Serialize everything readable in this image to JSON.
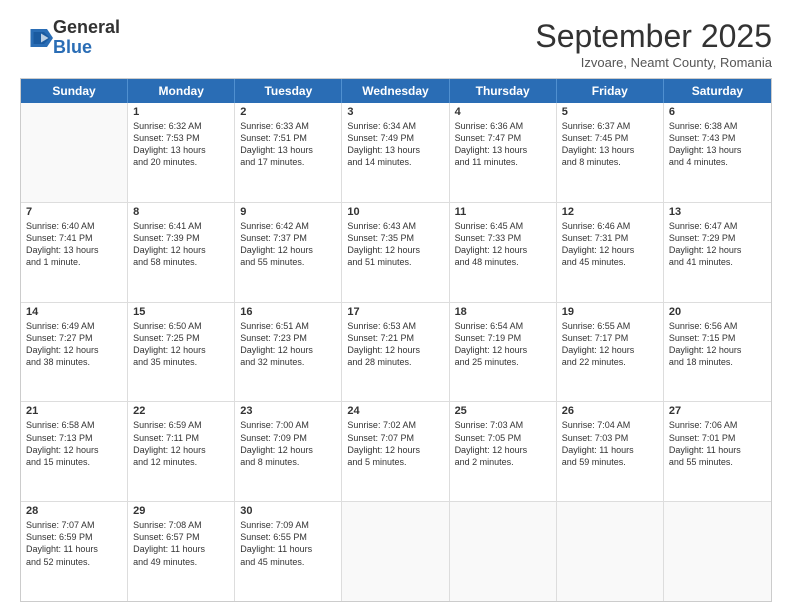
{
  "logo": {
    "general": "General",
    "blue": "Blue"
  },
  "header": {
    "title": "September 2025",
    "subtitle": "Izvoare, Neamt County, Romania"
  },
  "days": [
    "Sunday",
    "Monday",
    "Tuesday",
    "Wednesday",
    "Thursday",
    "Friday",
    "Saturday"
  ],
  "weeks": [
    [
      {
        "day": "",
        "lines": []
      },
      {
        "day": "1",
        "lines": [
          "Sunrise: 6:32 AM",
          "Sunset: 7:53 PM",
          "Daylight: 13 hours",
          "and 20 minutes."
        ]
      },
      {
        "day": "2",
        "lines": [
          "Sunrise: 6:33 AM",
          "Sunset: 7:51 PM",
          "Daylight: 13 hours",
          "and 17 minutes."
        ]
      },
      {
        "day": "3",
        "lines": [
          "Sunrise: 6:34 AM",
          "Sunset: 7:49 PM",
          "Daylight: 13 hours",
          "and 14 minutes."
        ]
      },
      {
        "day": "4",
        "lines": [
          "Sunrise: 6:36 AM",
          "Sunset: 7:47 PM",
          "Daylight: 13 hours",
          "and 11 minutes."
        ]
      },
      {
        "day": "5",
        "lines": [
          "Sunrise: 6:37 AM",
          "Sunset: 7:45 PM",
          "Daylight: 13 hours",
          "and 8 minutes."
        ]
      },
      {
        "day": "6",
        "lines": [
          "Sunrise: 6:38 AM",
          "Sunset: 7:43 PM",
          "Daylight: 13 hours",
          "and 4 minutes."
        ]
      }
    ],
    [
      {
        "day": "7",
        "lines": [
          "Sunrise: 6:40 AM",
          "Sunset: 7:41 PM",
          "Daylight: 13 hours",
          "and 1 minute."
        ]
      },
      {
        "day": "8",
        "lines": [
          "Sunrise: 6:41 AM",
          "Sunset: 7:39 PM",
          "Daylight: 12 hours",
          "and 58 minutes."
        ]
      },
      {
        "day": "9",
        "lines": [
          "Sunrise: 6:42 AM",
          "Sunset: 7:37 PM",
          "Daylight: 12 hours",
          "and 55 minutes."
        ]
      },
      {
        "day": "10",
        "lines": [
          "Sunrise: 6:43 AM",
          "Sunset: 7:35 PM",
          "Daylight: 12 hours",
          "and 51 minutes."
        ]
      },
      {
        "day": "11",
        "lines": [
          "Sunrise: 6:45 AM",
          "Sunset: 7:33 PM",
          "Daylight: 12 hours",
          "and 48 minutes."
        ]
      },
      {
        "day": "12",
        "lines": [
          "Sunrise: 6:46 AM",
          "Sunset: 7:31 PM",
          "Daylight: 12 hours",
          "and 45 minutes."
        ]
      },
      {
        "day": "13",
        "lines": [
          "Sunrise: 6:47 AM",
          "Sunset: 7:29 PM",
          "Daylight: 12 hours",
          "and 41 minutes."
        ]
      }
    ],
    [
      {
        "day": "14",
        "lines": [
          "Sunrise: 6:49 AM",
          "Sunset: 7:27 PM",
          "Daylight: 12 hours",
          "and 38 minutes."
        ]
      },
      {
        "day": "15",
        "lines": [
          "Sunrise: 6:50 AM",
          "Sunset: 7:25 PM",
          "Daylight: 12 hours",
          "and 35 minutes."
        ]
      },
      {
        "day": "16",
        "lines": [
          "Sunrise: 6:51 AM",
          "Sunset: 7:23 PM",
          "Daylight: 12 hours",
          "and 32 minutes."
        ]
      },
      {
        "day": "17",
        "lines": [
          "Sunrise: 6:53 AM",
          "Sunset: 7:21 PM",
          "Daylight: 12 hours",
          "and 28 minutes."
        ]
      },
      {
        "day": "18",
        "lines": [
          "Sunrise: 6:54 AM",
          "Sunset: 7:19 PM",
          "Daylight: 12 hours",
          "and 25 minutes."
        ]
      },
      {
        "day": "19",
        "lines": [
          "Sunrise: 6:55 AM",
          "Sunset: 7:17 PM",
          "Daylight: 12 hours",
          "and 22 minutes."
        ]
      },
      {
        "day": "20",
        "lines": [
          "Sunrise: 6:56 AM",
          "Sunset: 7:15 PM",
          "Daylight: 12 hours",
          "and 18 minutes."
        ]
      }
    ],
    [
      {
        "day": "21",
        "lines": [
          "Sunrise: 6:58 AM",
          "Sunset: 7:13 PM",
          "Daylight: 12 hours",
          "and 15 minutes."
        ]
      },
      {
        "day": "22",
        "lines": [
          "Sunrise: 6:59 AM",
          "Sunset: 7:11 PM",
          "Daylight: 12 hours",
          "and 12 minutes."
        ]
      },
      {
        "day": "23",
        "lines": [
          "Sunrise: 7:00 AM",
          "Sunset: 7:09 PM",
          "Daylight: 12 hours",
          "and 8 minutes."
        ]
      },
      {
        "day": "24",
        "lines": [
          "Sunrise: 7:02 AM",
          "Sunset: 7:07 PM",
          "Daylight: 12 hours",
          "and 5 minutes."
        ]
      },
      {
        "day": "25",
        "lines": [
          "Sunrise: 7:03 AM",
          "Sunset: 7:05 PM",
          "Daylight: 12 hours",
          "and 2 minutes."
        ]
      },
      {
        "day": "26",
        "lines": [
          "Sunrise: 7:04 AM",
          "Sunset: 7:03 PM",
          "Daylight: 11 hours",
          "and 59 minutes."
        ]
      },
      {
        "day": "27",
        "lines": [
          "Sunrise: 7:06 AM",
          "Sunset: 7:01 PM",
          "Daylight: 11 hours",
          "and 55 minutes."
        ]
      }
    ],
    [
      {
        "day": "28",
        "lines": [
          "Sunrise: 7:07 AM",
          "Sunset: 6:59 PM",
          "Daylight: 11 hours",
          "and 52 minutes."
        ]
      },
      {
        "day": "29",
        "lines": [
          "Sunrise: 7:08 AM",
          "Sunset: 6:57 PM",
          "Daylight: 11 hours",
          "and 49 minutes."
        ]
      },
      {
        "day": "30",
        "lines": [
          "Sunrise: 7:09 AM",
          "Sunset: 6:55 PM",
          "Daylight: 11 hours",
          "and 45 minutes."
        ]
      },
      {
        "day": "",
        "lines": []
      },
      {
        "day": "",
        "lines": []
      },
      {
        "day": "",
        "lines": []
      },
      {
        "day": "",
        "lines": []
      }
    ]
  ]
}
